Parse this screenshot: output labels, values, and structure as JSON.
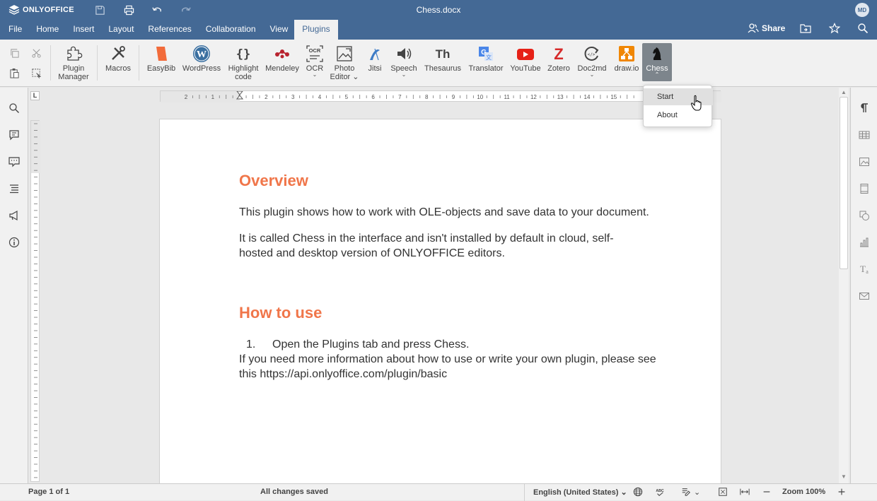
{
  "app": {
    "name": "ONLYOFFICE",
    "doc_title": "Chess.docx",
    "user_initials": "MD"
  },
  "menu": {
    "tabs": [
      "File",
      "Home",
      "Insert",
      "Layout",
      "References",
      "Collaboration",
      "View",
      "Plugins"
    ],
    "active_tab": "Plugins",
    "share_label": "Share"
  },
  "toolbar": {
    "plugins": [
      {
        "label": "Plugin\nManager",
        "name": "plugin-manager"
      },
      {
        "label": "Macros",
        "name": "macros"
      },
      {
        "label": "EasyBib",
        "name": "easybib"
      },
      {
        "label": "WordPress",
        "name": "wordpress"
      },
      {
        "label": "Highlight\ncode",
        "name": "highlight-code"
      },
      {
        "label": "Mendeley",
        "name": "mendeley"
      },
      {
        "label": "OCR",
        "name": "ocr"
      },
      {
        "label": "Photo\nEditor",
        "name": "photo-editor"
      },
      {
        "label": "Jitsi",
        "name": "jitsi"
      },
      {
        "label": "Speech",
        "name": "speech"
      },
      {
        "label": "Thesaurus",
        "name": "thesaurus"
      },
      {
        "label": "Translator",
        "name": "translator"
      },
      {
        "label": "YouTube",
        "name": "youtube"
      },
      {
        "label": "Zotero",
        "name": "zotero"
      },
      {
        "label": "Doc2md",
        "name": "doc2md"
      },
      {
        "label": "draw.io",
        "name": "drawio"
      },
      {
        "label": "Chess",
        "name": "chess"
      }
    ]
  },
  "dropdown": {
    "items": [
      "Start",
      "About"
    ]
  },
  "document": {
    "heading1": "Overview",
    "para1": "This plugin shows how to work with OLE-objects and save data to your document.",
    "para2": "It is called Chess in the interface and isn't installed by default in cloud, self-hosted and desktop version of ONLYOFFICE editors.",
    "heading2": "How to use",
    "list_num": "1.",
    "list_item": "Open the Plugins tab and press Chess.",
    "para3": "If you need more information about how to use or write your own plugin, please see this https://api.onlyoffice.com/plugin/basic"
  },
  "ruler": {
    "h_ticks": [
      "2",
      "1",
      "1",
      "2",
      "3",
      "4",
      "5",
      "6",
      "7",
      "8",
      "9",
      "10",
      "11",
      "12",
      "13",
      "14",
      "15"
    ],
    "tab_selector": "L"
  },
  "status": {
    "page": "Page 1 of 1",
    "saved": "All changes saved",
    "language": "English (United States)",
    "zoom": "Zoom 100%"
  },
  "colors": {
    "header": "#446995",
    "heading": "#f0764a"
  }
}
